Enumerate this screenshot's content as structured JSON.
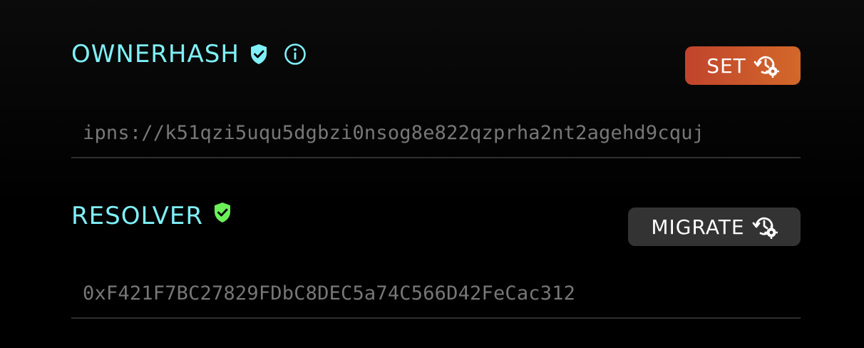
{
  "ownerhash": {
    "title": "OWNERHASH",
    "title_color": "#7ff0f8",
    "verified_icon": "shield-check-icon",
    "verified_color": "#7ff0f8",
    "info_icon": "info-circle-icon",
    "button_label": "SET",
    "button_icon": "history-settings-icon",
    "button_colors": [
      "#c0442c",
      "#d3682a"
    ],
    "value": "ipns://k51qzi5uqu5dgbzi0nsog8e822qzprha2nt2agehd9cquj"
  },
  "resolver": {
    "title": "RESOLVER",
    "title_color": "#7ff0f8",
    "verified_icon": "shield-check-icon",
    "verified_color": "#6cf05a",
    "button_label": "MIGRATE",
    "button_icon": "history-settings-icon",
    "button_color": "#333333",
    "value": "0xF421F7BC27829FDbC8DEC5a74C566D42FeCac312"
  }
}
